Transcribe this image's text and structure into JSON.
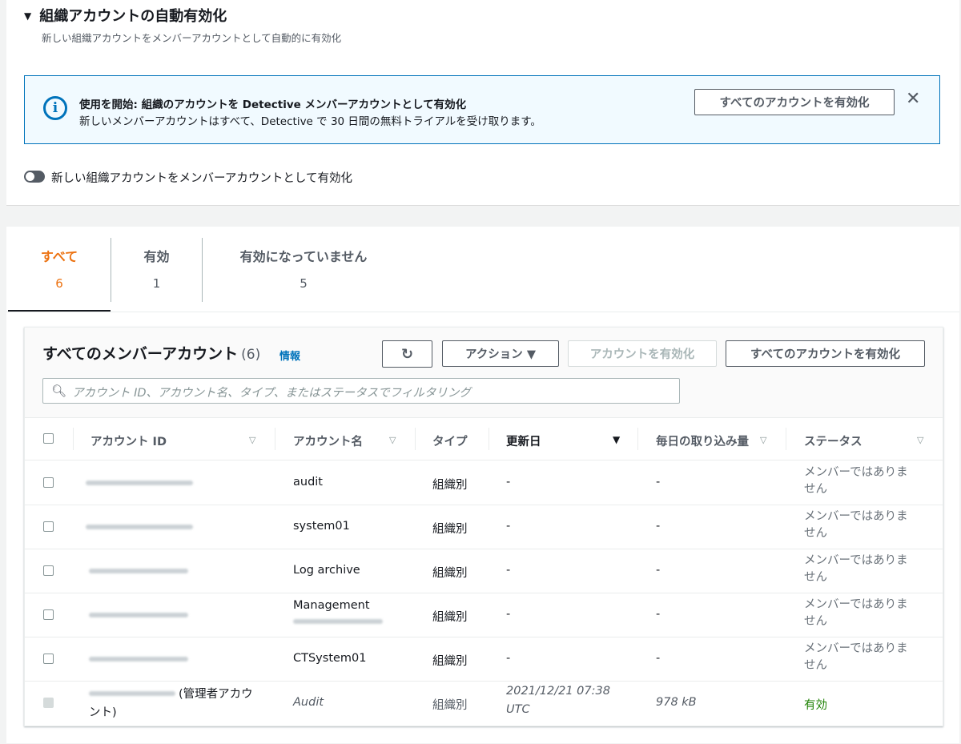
{
  "section": {
    "title": "組織アカウントの自動有効化",
    "description": "新しい組織アカウントをメンバーアカウントとして自動的に有効化"
  },
  "banner": {
    "title": "使用を開始: 組織のアカウントを Detective メンバーアカウントとして有効化",
    "text": "新しいメンバーアカウントはすべて、Detective で 30 日間の無料トライアルを受け取ります。",
    "button_label": "すべてのアカウントを有効化",
    "close_icon": "close-icon",
    "info_icon": "info-icon",
    "accent": "#0073bb"
  },
  "toggle": {
    "label": "新しい組織アカウントをメンバーアカウントとして有効化",
    "state": "off"
  },
  "tabs": [
    {
      "label": "すべて",
      "count": "6"
    },
    {
      "label": "有効",
      "count": "1"
    },
    {
      "label": "有効になっていません",
      "count": "5"
    }
  ],
  "table": {
    "title": "すべてのメンバーアカウント",
    "count": "(6)",
    "info_link": "情報",
    "refresh_icon": "refresh-icon",
    "actions_label": "アクション ▼",
    "enable_account_label": "アカウントを有効化",
    "enable_all_label": "すべてのアカウントを有効化",
    "search_placeholder": "アカウント ID、アカウント名、タイプ、またはステータスでフィルタリング",
    "columns": [
      "アカウント ID",
      "アカウント名",
      "タイプ",
      "更新日",
      "毎日の取り込み量",
      "ステータス"
    ],
    "rows": [
      {
        "name": "audit",
        "type": "組織別",
        "updated": "-",
        "volume": "-",
        "status_l1": "メンバーではありま",
        "status_l2": "せん"
      },
      {
        "name": "system01",
        "type": "組織別",
        "updated": "-",
        "volume": "-",
        "status_l1": "メンバーではありま",
        "status_l2": "せん"
      },
      {
        "name": "Log archive",
        "type": "組織別",
        "updated": "-",
        "volume": "-",
        "status_l1": "メンバーではありま",
        "status_l2": "せん"
      },
      {
        "name": "Management",
        "type": "組織別",
        "updated": "-",
        "volume": "-",
        "status_l1": "メンバーではありま",
        "status_l2": "せん"
      },
      {
        "name": "CTSystem01",
        "type": "組織別",
        "updated": "-",
        "volume": "-",
        "status_l1": "メンバーではありま",
        "status_l2": "せん"
      }
    ],
    "admin_row": {
      "id_suffix_l1": "(管理者アカウ",
      "id_suffix_l2": "ント)",
      "name": "Audit",
      "type": "組織別",
      "updated_l1": "2021/12/21 07:38",
      "updated_l2": "UTC",
      "volume": "978 kB",
      "status": "有効",
      "status_color": "#1d8102"
    }
  },
  "colors": {
    "active_tab": "#ec7211",
    "link": "#0073bb"
  }
}
